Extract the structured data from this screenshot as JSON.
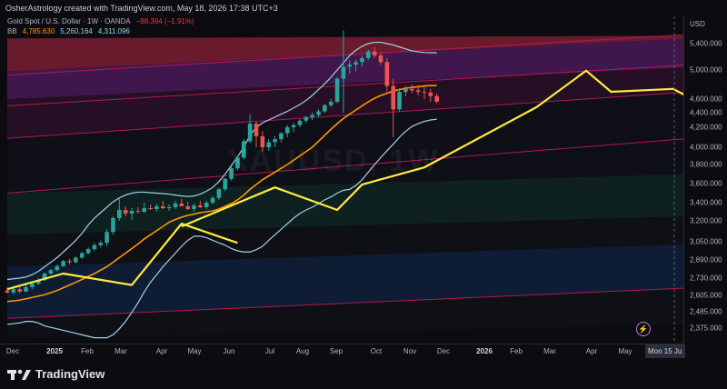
{
  "header": {
    "credit": "OsherAstrology created with TradingView.com, May 18, 2026 17:38 UTC+3"
  },
  "legend": {
    "symbol": "Gold Spot / U.S. Dollar · 1W · OANDA",
    "change": "−88.394 (−1.91%)",
    "bb_label": "BB",
    "bb_basis": "4,785.630",
    "bb_upper": "5,260.164",
    "bb_lower": "4,311.096"
  },
  "watermark": "XAUUSD, 1W",
  "price_axis": {
    "currency": "USD",
    "ticks": [
      "5,400.000",
      "5,000.000",
      "4,600.000",
      "4,400.000",
      "4,200.000",
      "4,000.000",
      "3,800.000",
      "3,600.000",
      "3,400.000",
      "3,200.000",
      "3,050.000",
      "2,890.000",
      "2,730.000",
      "2,605.000",
      "2,485.000",
      "2,375.000"
    ]
  },
  "time_axis": {
    "labels": [
      "Dec",
      "2025",
      "Feb",
      "Mar",
      "Apr",
      "May",
      "Jun",
      "Jul",
      "Aug",
      "Sep",
      "Oct",
      "Nov",
      "Dec",
      "2026",
      "Feb",
      "Mar",
      "Apr",
      "May"
    ],
    "bold_labels": [
      "2025",
      "2026"
    ],
    "cursor_label": "Mon 15 Ju"
  },
  "footer": {
    "brand": "TradingView"
  },
  "colors": {
    "up": "#26a69a",
    "down": "#ef5350",
    "bb_basis": "#ff9800",
    "bb_band": "#9fd3e6",
    "astro_line": "#ffeb3b",
    "channel": "#c2185b"
  },
  "chart_data": {
    "type": "candlestick",
    "timeframe": "1W",
    "symbol": "Gold Spot / U.S. Dollar",
    "candles": [
      {
        "o": 2640,
        "h": 2662,
        "l": 2620,
        "c": 2625
      },
      {
        "o": 2625,
        "h": 2660,
        "l": 2610,
        "c": 2650
      },
      {
        "o": 2650,
        "h": 2665,
        "l": 2620,
        "c": 2632
      },
      {
        "o": 2632,
        "h": 2680,
        "l": 2630,
        "c": 2665
      },
      {
        "o": 2665,
        "h": 2700,
        "l": 2650,
        "c": 2690
      },
      {
        "o": 2690,
        "h": 2730,
        "l": 2680,
        "c": 2715
      },
      {
        "o": 2715,
        "h": 2780,
        "l": 2710,
        "c": 2770
      },
      {
        "o": 2770,
        "h": 2810,
        "l": 2760,
        "c": 2800
      },
      {
        "o": 2800,
        "h": 2850,
        "l": 2790,
        "c": 2835
      },
      {
        "o": 2835,
        "h": 2890,
        "l": 2830,
        "c": 2880
      },
      {
        "o": 2880,
        "h": 2900,
        "l": 2850,
        "c": 2870
      },
      {
        "o": 2870,
        "h": 2920,
        "l": 2860,
        "c": 2910
      },
      {
        "o": 2910,
        "h": 2960,
        "l": 2900,
        "c": 2950
      },
      {
        "o": 2950,
        "h": 3000,
        "l": 2940,
        "c": 2985
      },
      {
        "o": 2985,
        "h": 3040,
        "l": 2970,
        "c": 3020
      },
      {
        "o": 3020,
        "h": 3060,
        "l": 3000,
        "c": 3040
      },
      {
        "o": 3040,
        "h": 3140,
        "l": 3010,
        "c": 3120
      },
      {
        "o": 3120,
        "h": 3250,
        "l": 3100,
        "c": 3230
      },
      {
        "o": 3230,
        "h": 3440,
        "l": 3200,
        "c": 3320
      },
      {
        "o": 3320,
        "h": 3360,
        "l": 3250,
        "c": 3280
      },
      {
        "o": 3280,
        "h": 3340,
        "l": 3210,
        "c": 3310
      },
      {
        "o": 3310,
        "h": 3350,
        "l": 3280,
        "c": 3300
      },
      {
        "o": 3300,
        "h": 3400,
        "l": 3290,
        "c": 3340
      },
      {
        "o": 3340,
        "h": 3380,
        "l": 3320,
        "c": 3330
      },
      {
        "o": 3330,
        "h": 3390,
        "l": 3300,
        "c": 3360
      },
      {
        "o": 3360,
        "h": 3420,
        "l": 3330,
        "c": 3340
      },
      {
        "o": 3340,
        "h": 3380,
        "l": 3310,
        "c": 3350
      },
      {
        "o": 3350,
        "h": 3420,
        "l": 3330,
        "c": 3390
      },
      {
        "o": 3390,
        "h": 3440,
        "l": 3360,
        "c": 3360
      },
      {
        "o": 3360,
        "h": 3410,
        "l": 3320,
        "c": 3330
      },
      {
        "o": 3330,
        "h": 3390,
        "l": 3300,
        "c": 3370
      },
      {
        "o": 3370,
        "h": 3420,
        "l": 3340,
        "c": 3350
      },
      {
        "o": 3350,
        "h": 3420,
        "l": 3330,
        "c": 3400
      },
      {
        "o": 3400,
        "h": 3470,
        "l": 3380,
        "c": 3450
      },
      {
        "o": 3450,
        "h": 3560,
        "l": 3430,
        "c": 3540
      },
      {
        "o": 3540,
        "h": 3660,
        "l": 3520,
        "c": 3650
      },
      {
        "o": 3650,
        "h": 3780,
        "l": 3630,
        "c": 3760
      },
      {
        "o": 3760,
        "h": 3900,
        "l": 3740,
        "c": 3880
      },
      {
        "o": 3880,
        "h": 4080,
        "l": 3860,
        "c": 4060
      },
      {
        "o": 4060,
        "h": 4380,
        "l": 4040,
        "c": 4250
      },
      {
        "o": 4250,
        "h": 4280,
        "l": 4000,
        "c": 4110
      },
      {
        "o": 4110,
        "h": 4160,
        "l": 3950,
        "c": 4000
      },
      {
        "o": 4000,
        "h": 4080,
        "l": 3960,
        "c": 4050
      },
      {
        "o": 4050,
        "h": 4110,
        "l": 4000,
        "c": 4080
      },
      {
        "o": 4080,
        "h": 4150,
        "l": 4050,
        "c": 4140
      },
      {
        "o": 4140,
        "h": 4230,
        "l": 4100,
        "c": 4200
      },
      {
        "o": 4200,
        "h": 4260,
        "l": 4150,
        "c": 4230
      },
      {
        "o": 4230,
        "h": 4310,
        "l": 4200,
        "c": 4290
      },
      {
        "o": 4290,
        "h": 4360,
        "l": 4260,
        "c": 4340
      },
      {
        "o": 4340,
        "h": 4400,
        "l": 4300,
        "c": 4370
      },
      {
        "o": 4370,
        "h": 4450,
        "l": 4340,
        "c": 4420
      },
      {
        "o": 4420,
        "h": 4530,
        "l": 4400,
        "c": 4510
      },
      {
        "o": 4510,
        "h": 4600,
        "l": 4480,
        "c": 4560
      },
      {
        "o": 4560,
        "h": 4900,
        "l": 4540,
        "c": 4880
      },
      {
        "o": 4880,
        "h": 5600,
        "l": 4400,
        "c": 5050
      },
      {
        "o": 5050,
        "h": 5150,
        "l": 4950,
        "c": 5080
      },
      {
        "o": 5080,
        "h": 5160,
        "l": 4980,
        "c": 5120
      },
      {
        "o": 5120,
        "h": 5220,
        "l": 5050,
        "c": 5180
      },
      {
        "o": 5180,
        "h": 5310,
        "l": 5150,
        "c": 5280
      },
      {
        "o": 5280,
        "h": 5350,
        "l": 5180,
        "c": 5220
      },
      {
        "o": 5220,
        "h": 5260,
        "l": 5080,
        "c": 5120
      },
      {
        "o": 5120,
        "h": 5180,
        "l": 4700,
        "c": 4780
      },
      {
        "o": 4780,
        "h": 4880,
        "l": 4100,
        "c": 4450
      },
      {
        "o": 4450,
        "h": 4750,
        "l": 4420,
        "c": 4700
      },
      {
        "o": 4700,
        "h": 4780,
        "l": 4640,
        "c": 4740
      },
      {
        "o": 4740,
        "h": 4800,
        "l": 4680,
        "c": 4720
      },
      {
        "o": 4720,
        "h": 4790,
        "l": 4650,
        "c": 4700
      },
      {
        "o": 4700,
        "h": 4760,
        "l": 4600,
        "c": 4690
      },
      {
        "o": 4690,
        "h": 4740,
        "l": 4560,
        "c": 4640
      },
      {
        "o": 4640,
        "h": 4680,
        "l": 4540,
        "c": 4560
      }
    ],
    "bb_basis_values": [
      2560,
      2565,
      2570,
      2580,
      2590,
      2600,
      2610,
      2625,
      2640,
      2660,
      2680,
      2700,
      2720,
      2745,
      2770,
      2800,
      2830,
      2870,
      2910,
      2950,
      2990,
      3030,
      3070,
      3100,
      3130,
      3160,
      3190,
      3215,
      3240,
      3260,
      3275,
      3290,
      3300,
      3310,
      3330,
      3360,
      3390,
      3430,
      3480,
      3540,
      3590,
      3640,
      3680,
      3720,
      3760,
      3800,
      3850,
      3900,
      3950,
      4000,
      4060,
      4120,
      4180,
      4250,
      4320,
      4380,
      4440,
      4500,
      4560,
      4610,
      4650,
      4680,
      4710,
      4730,
      4750,
      4760,
      4770,
      4780,
      4785,
      4786
    ],
    "bb_upper_values": [
      2720,
      2725,
      2730,
      2740,
      2760,
      2790,
      2830,
      2870,
      2910,
      2960,
      3010,
      3060,
      3110,
      3170,
      3230,
      3290,
      3350,
      3410,
      3450,
      3480,
      3500,
      3510,
      3510,
      3505,
      3500,
      3495,
      3490,
      3480,
      3470,
      3465,
      3470,
      3490,
      3520,
      3560,
      3620,
      3700,
      3790,
      3890,
      4000,
      4120,
      4200,
      4260,
      4300,
      4340,
      4380,
      4420,
      4470,
      4520,
      4580,
      4650,
      4730,
      4810,
      4900,
      5000,
      5110,
      5220,
      5300,
      5360,
      5400,
      5420,
      5420,
      5400,
      5380,
      5350,
      5320,
      5290,
      5275,
      5265,
      5262,
      5260
    ],
    "bb_lower_values": [
      2400,
      2405,
      2410,
      2420,
      2420,
      2410,
      2390,
      2380,
      2370,
      2360,
      2350,
      2340,
      2330,
      2320,
      2310,
      2310,
      2310,
      2330,
      2370,
      2420,
      2480,
      2550,
      2630,
      2700,
      2760,
      2830,
      2890,
      2950,
      3010,
      3060,
      3090,
      3090,
      3080,
      3060,
      3040,
      3020,
      2990,
      2970,
      2960,
      2960,
      2980,
      3010,
      3060,
      3100,
      3140,
      3180,
      3230,
      3280,
      3320,
      3350,
      3390,
      3430,
      3460,
      3500,
      3530,
      3540,
      3580,
      3640,
      3720,
      3800,
      3880,
      3960,
      4030,
      4100,
      4160,
      4210,
      4250,
      4280,
      4300,
      4311
    ],
    "astro_lines": [
      [
        [
          0,
          2650
        ],
        [
          9,
          2770
        ],
        [
          20,
          2680
        ],
        [
          28,
          3180
        ],
        [
          37,
          3040
        ]
      ],
      [
        [
          28,
          3160
        ],
        [
          43,
          3560
        ],
        [
          53,
          3320
        ],
        [
          57,
          3590
        ],
        [
          67,
          3770
        ],
        [
          85,
          4480
        ],
        [
          93,
          4990
        ],
        [
          97,
          4700
        ],
        [
          107,
          4740
        ],
        [
          110,
          4600
        ]
      ]
    ],
    "channel_lines": [
      [
        [
          0,
          4930
        ],
        [
          110,
          5540
        ]
      ],
      [
        [
          0,
          4500
        ],
        [
          110,
          5080
        ]
      ],
      [
        [
          0,
          4090
        ],
        [
          110,
          4700
        ]
      ],
      [
        [
          0,
          3500
        ],
        [
          110,
          4090
        ]
      ],
      [
        [
          0,
          2440
        ],
        [
          110,
          2660
        ]
      ]
    ],
    "zones": [
      {
        "color": "#7a1f33",
        "top": [
          [
            0,
            5480
          ],
          [
            110,
            5520
          ]
        ],
        "bottom": [
          [
            0,
            4980
          ],
          [
            110,
            5480
          ]
        ]
      },
      {
        "color": "#4a1a57",
        "top": [
          [
            0,
            4980
          ],
          [
            110,
            5480
          ]
        ],
        "bottom": [
          [
            0,
            4600
          ],
          [
            110,
            5040
          ]
        ]
      },
      {
        "color": "#2a1028",
        "top": [
          [
            0,
            4600
          ],
          [
            110,
            5040
          ]
        ],
        "bottom": [
          [
            0,
            4090
          ],
          [
            110,
            4700
          ]
        ]
      },
      {
        "color": "#101019",
        "top": [
          [
            0,
            4090
          ],
          [
            110,
            4700
          ]
        ],
        "bottom": [
          [
            0,
            3500
          ],
          [
            110,
            3700
          ]
        ]
      },
      {
        "color": "#0f2522",
        "top": [
          [
            0,
            3500
          ],
          [
            110,
            3700
          ]
        ],
        "bottom": [
          [
            0,
            3100
          ],
          [
            110,
            3250
          ]
        ]
      },
      {
        "color": "#111118",
        "top": [
          [
            0,
            3100
          ],
          [
            110,
            3250
          ]
        ],
        "bottom": [
          [
            0,
            2830
          ],
          [
            110,
            3030
          ]
        ]
      },
      {
        "color": "#0f213a",
        "top": [
          [
            0,
            2830
          ],
          [
            110,
            3030
          ]
        ],
        "bottom": [
          [
            0,
            2440
          ],
          [
            110,
            2660
          ]
        ]
      },
      {
        "color": "#111118",
        "top": [
          [
            0,
            2440
          ],
          [
            110,
            2660
          ]
        ],
        "bottom": [
          [
            0,
            2300
          ],
          [
            110,
            2400
          ]
        ]
      }
    ]
  }
}
